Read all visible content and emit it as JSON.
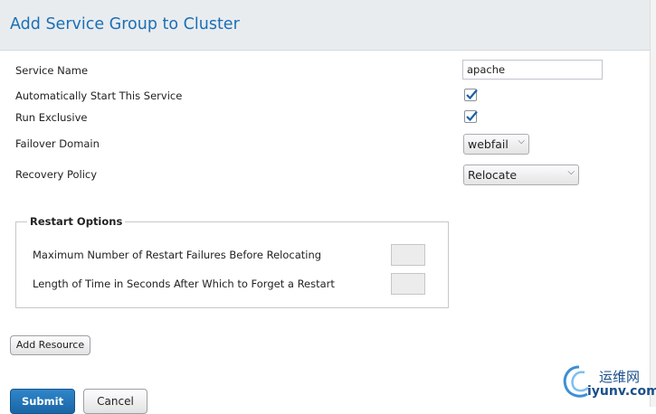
{
  "header": {
    "title": "Add Service Group to Cluster"
  },
  "form": {
    "service_name": {
      "label": "Service Name",
      "value": "apache"
    },
    "autostart": {
      "label": "Automatically Start This Service",
      "checked": true
    },
    "run_exclusive": {
      "label": "Run Exclusive",
      "checked": true
    },
    "failover_domain": {
      "label": "Failover Domain",
      "selected": "webfail"
    },
    "recovery_policy": {
      "label": "Recovery Policy",
      "selected": "Relocate"
    }
  },
  "restart_options": {
    "legend": "Restart Options",
    "max_failures_label": "Maximum Number of Restart Failures Before Relocating",
    "max_failures_value": "",
    "forget_time_label": "Length of Time in Seconds After Which to Forget a Restart",
    "forget_time_value": ""
  },
  "buttons": {
    "add_resource": "Add Resource",
    "submit": "Submit",
    "cancel": "Cancel"
  },
  "watermark": {
    "line1": "运维网",
    "line2": "iyunv.com"
  },
  "colors": {
    "title_blue": "#1a6fb5",
    "primary_button": "#1f6fb2",
    "header_bg": "#e9ecef"
  }
}
